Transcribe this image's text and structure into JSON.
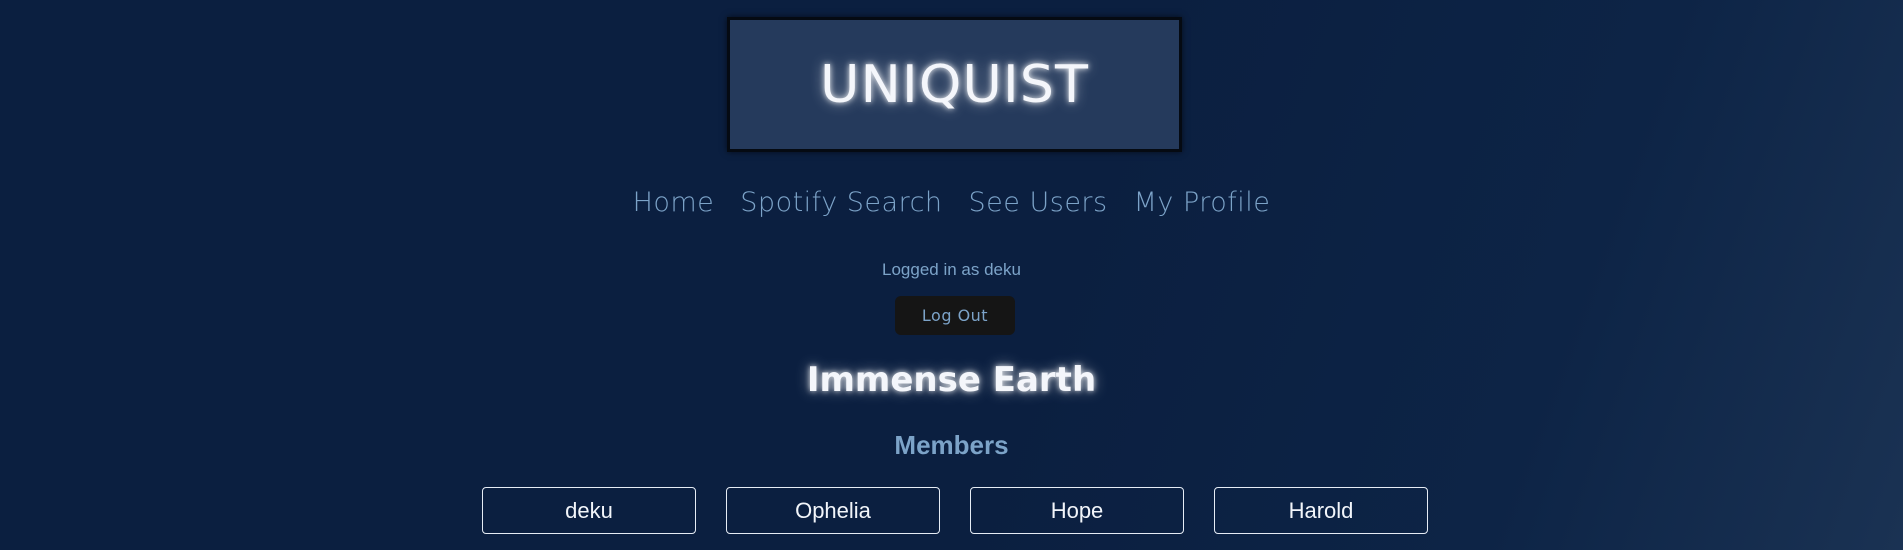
{
  "header": {
    "logo_text": "UNIQUIST"
  },
  "nav": {
    "items": [
      {
        "label": "Home"
      },
      {
        "label": "Spotify Search"
      },
      {
        "label": "See Users"
      },
      {
        "label": "My Profile"
      }
    ]
  },
  "session": {
    "status_text": "Logged in as deku",
    "logout_label": "Log Out"
  },
  "group": {
    "title": "Immense Earth",
    "members_heading": "Members",
    "members": [
      "deku",
      "Ophelia",
      "Hope",
      "Harold"
    ]
  },
  "colors": {
    "background": "#0b1f40",
    "header_box": "#253a5c",
    "accent_text": "#7ca3c8",
    "glow_text": "#f4f6fb",
    "button_bg": "#151515"
  }
}
